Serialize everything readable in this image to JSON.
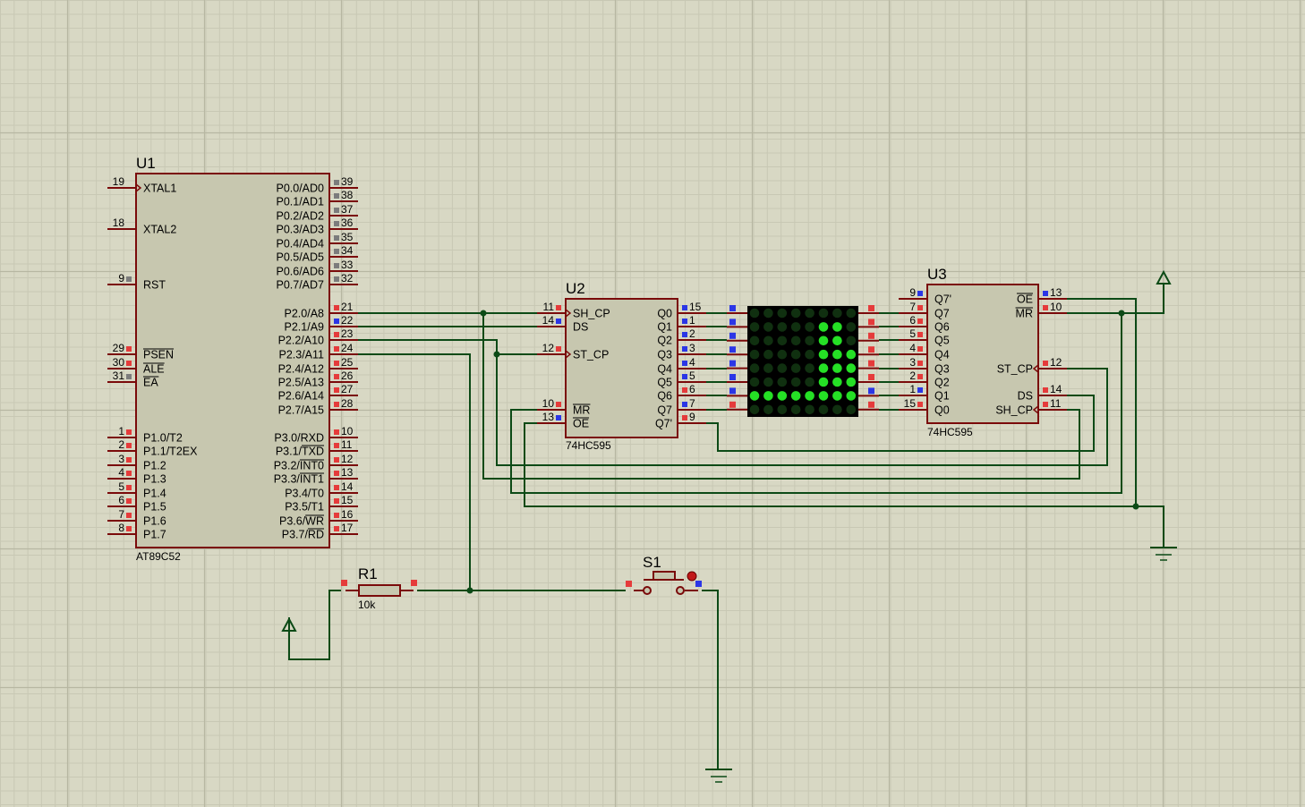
{
  "colors": {
    "background": "#d8d8c4",
    "grid_minor": "#c8c8b4",
    "grid_major": "#b7b7a2",
    "component_body": "#c7c7af",
    "component_outline": "#7a0a0a",
    "wire": "#0c4a16",
    "pin_red": "#e53b3b",
    "pin_blue": "#2b36e6",
    "pin_gray": "#7c7c7c",
    "led_on": "#25e025",
    "led_off": "#103010",
    "matrix_bg": "#000000"
  },
  "u1": {
    "ref": "U1",
    "part": "AT89C52",
    "left_pins": [
      {
        "num": "19",
        "name": "XTAL1",
        "clock": true,
        "state": "none"
      },
      {
        "num": "18",
        "name": "XTAL2",
        "state": "none"
      },
      {
        "num": "9",
        "name": "RST",
        "state": "gray"
      },
      {
        "num": "29",
        "name": "PSEN",
        "bar": true,
        "state": "red"
      },
      {
        "num": "30",
        "name": "ALE",
        "bar": true,
        "state": "red"
      },
      {
        "num": "31",
        "name": "EA",
        "bar": true,
        "state": "gray"
      },
      {
        "num": "1",
        "name": "P1.0/T2",
        "state": "red"
      },
      {
        "num": "2",
        "name": "P1.1/T2EX",
        "state": "red"
      },
      {
        "num": "3",
        "name": "P1.2",
        "state": "red"
      },
      {
        "num": "4",
        "name": "P1.3",
        "state": "red"
      },
      {
        "num": "5",
        "name": "P1.4",
        "state": "red"
      },
      {
        "num": "6",
        "name": "P1.5",
        "state": "red"
      },
      {
        "num": "7",
        "name": "P1.6",
        "state": "red"
      },
      {
        "num": "8",
        "name": "P1.7",
        "state": "red"
      }
    ],
    "right_pins": [
      {
        "num": "39",
        "name": "P0.0/AD0",
        "state": "gray"
      },
      {
        "num": "38",
        "name": "P0.1/AD1",
        "state": "gray"
      },
      {
        "num": "37",
        "name": "P0.2/AD2",
        "state": "gray"
      },
      {
        "num": "36",
        "name": "P0.3/AD3",
        "state": "gray"
      },
      {
        "num": "35",
        "name": "P0.4/AD4",
        "state": "gray"
      },
      {
        "num": "34",
        "name": "P0.5/AD5",
        "state": "gray"
      },
      {
        "num": "33",
        "name": "P0.6/AD6",
        "state": "gray"
      },
      {
        "num": "32",
        "name": "P0.7/AD7",
        "state": "gray"
      },
      {
        "num": "21",
        "name": "P2.0/A8",
        "state": "red"
      },
      {
        "num": "22",
        "name": "P2.1/A9",
        "state": "blue"
      },
      {
        "num": "23",
        "name": "P2.2/A10",
        "state": "red"
      },
      {
        "num": "24",
        "name": "P2.3/A11",
        "state": "red"
      },
      {
        "num": "25",
        "name": "P2.4/A12",
        "state": "red"
      },
      {
        "num": "26",
        "name": "P2.5/A13",
        "state": "red"
      },
      {
        "num": "27",
        "name": "P2.6/A14",
        "state": "red"
      },
      {
        "num": "28",
        "name": "P2.7/A15",
        "state": "red"
      },
      {
        "num": "10",
        "name": "P3.0/RXD",
        "state": "red"
      },
      {
        "num": "11",
        "name": "P3.1/TXD",
        "bar_part": "TXD",
        "state": "red"
      },
      {
        "num": "12",
        "name": "P3.2/INT0",
        "bar_part": "INT0",
        "state": "red"
      },
      {
        "num": "13",
        "name": "P3.3/INT1",
        "bar_part": "INT1",
        "state": "red"
      },
      {
        "num": "14",
        "name": "P3.4/T0",
        "state": "red"
      },
      {
        "num": "15",
        "name": "P3.5/T1",
        "state": "red"
      },
      {
        "num": "16",
        "name": "P3.6/WR",
        "bar_part": "WR",
        "state": "red"
      },
      {
        "num": "17",
        "name": "P3.7/RD",
        "bar_part": "RD",
        "state": "red"
      }
    ]
  },
  "u2": {
    "ref": "U2",
    "part": "74HC595",
    "left_pins": [
      {
        "num": "11",
        "name": "SH_CP",
        "clock": true,
        "state": "red"
      },
      {
        "num": "14",
        "name": "DS",
        "state": "blue"
      },
      {
        "num": "12",
        "name": "ST_CP",
        "clock": true,
        "state": "red"
      },
      {
        "num": "10",
        "name": "MR",
        "bar": true,
        "state": "red"
      },
      {
        "num": "13",
        "name": "OE",
        "bar": true,
        "state": "blue"
      }
    ],
    "right_pins": [
      {
        "num": "15",
        "name": "Q0",
        "state": "blue"
      },
      {
        "num": "1",
        "name": "Q1",
        "state": "blue"
      },
      {
        "num": "2",
        "name": "Q2",
        "state": "blue"
      },
      {
        "num": "3",
        "name": "Q3",
        "state": "blue"
      },
      {
        "num": "4",
        "name": "Q4",
        "state": "blue"
      },
      {
        "num": "5",
        "name": "Q5",
        "state": "blue"
      },
      {
        "num": "6",
        "name": "Q6",
        "state": "red"
      },
      {
        "num": "7",
        "name": "Q7",
        "state": "blue"
      },
      {
        "num": "9",
        "name": "Q7'",
        "state": "red"
      }
    ]
  },
  "u3": {
    "ref": "U3",
    "part": "74HC595",
    "left_pins": [
      {
        "num": "9",
        "name": "Q7'",
        "state": "blue"
      },
      {
        "num": "7",
        "name": "Q7",
        "state": "red"
      },
      {
        "num": "6",
        "name": "Q6",
        "state": "red"
      },
      {
        "num": "5",
        "name": "Q5",
        "state": "red"
      },
      {
        "num": "4",
        "name": "Q4",
        "state": "red"
      },
      {
        "num": "3",
        "name": "Q3",
        "state": "red"
      },
      {
        "num": "2",
        "name": "Q2",
        "state": "red"
      },
      {
        "num": "1",
        "name": "Q1",
        "state": "blue"
      },
      {
        "num": "15",
        "name": "Q0",
        "state": "red"
      }
    ],
    "right_pins": [
      {
        "num": "13",
        "name": "OE",
        "bar": true,
        "state": "blue"
      },
      {
        "num": "10",
        "name": "MR",
        "bar": true,
        "state": "red"
      },
      {
        "num": "12",
        "name": "ST_CP",
        "clock": true,
        "state": "red"
      },
      {
        "num": "14",
        "name": "DS",
        "state": "red"
      },
      {
        "num": "11",
        "name": "SH_CP",
        "clock": true,
        "state": "red"
      }
    ]
  },
  "r1": {
    "ref": "R1",
    "value": "10k"
  },
  "s1": {
    "ref": "S1"
  },
  "led_matrix": {
    "rows": 8,
    "cols": 8,
    "lit": [
      "00000000",
      "00000110",
      "00000110",
      "00000111",
      "00000111",
      "00000111",
      "11111111",
      "00000000"
    ],
    "left_pin_states": [
      "blue",
      "blue",
      "blue",
      "blue",
      "blue",
      "blue",
      "blue",
      "red"
    ],
    "right_pin_states": [
      "red",
      "red",
      "red",
      "red",
      "red",
      "red",
      "blue",
      "red"
    ]
  }
}
